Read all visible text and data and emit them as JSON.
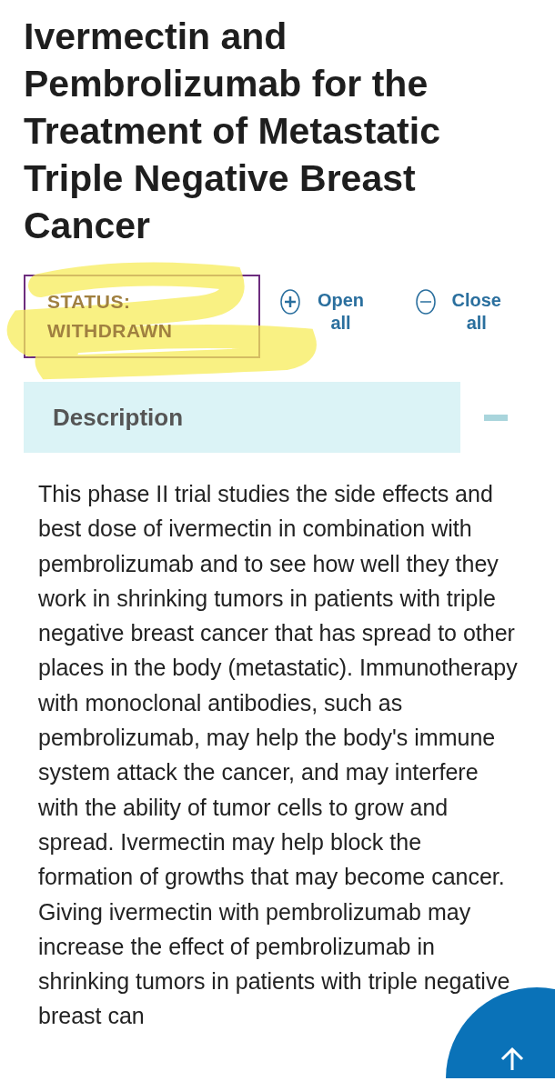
{
  "title": "Ivermectin and Pembrolizumab for the Treatment of Metastatic Triple Negative Breast Cancer",
  "status": {
    "text": "STATUS: WITHDRAWN",
    "highlighted": true
  },
  "controls": [
    {
      "kind": "open",
      "label": "Open all"
    },
    {
      "kind": "close",
      "label": "Close all"
    }
  ],
  "sections": [
    {
      "heading": "Description",
      "expanded": true,
      "body": "This phase II trial studies the side effects and best dose of ivermectin in combination with pembrolizumab and to see how well they they work in shrinking tumors in patients with triple negative breast cancer that has spread to other places in the body (metastatic). Immunotherapy with monoclonal antibodies, such as pembrolizumab, may help the body's immune system attack the cancer, and may interfere with the ability of tumor cells to grow and spread. Ivermectin may help block the formation of growths that may become cancer. Giving ivermectin with pembrolizumab may increase the effect of pembrolizumab in shrinking tumors in patients with triple negative breast can"
    }
  ]
}
